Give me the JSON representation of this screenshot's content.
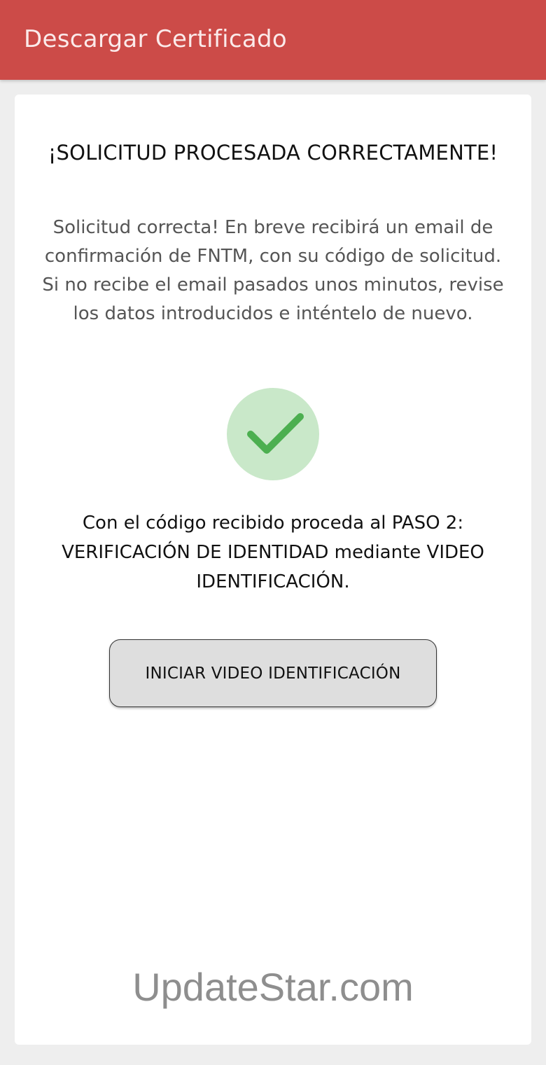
{
  "appbar": {
    "title": "Descargar Certificado",
    "color": "#cc4b48"
  },
  "content": {
    "heading": "¡SOLICITUD PROCESADA CORRECTAMENTE!",
    "message": "Solicitud correcta! En breve recibirá un email de confirmación de FNTM, con su código de solicitud. Si no recibe el email pasados unos minutos, revise los datos introducidos e inténtelo de nuevo.",
    "status_icon": "check-icon",
    "status_color": "#4caf50",
    "instruction": "Con el código recibido proceda al PASO 2: VERIFICACIÓN DE IDENTIDAD mediante VIDEO IDENTIFICACIÓN.",
    "start_button_label": "INICIAR VIDEO IDENTIFICACIÓN"
  },
  "watermark": {
    "text": "UpdateStar.com"
  }
}
